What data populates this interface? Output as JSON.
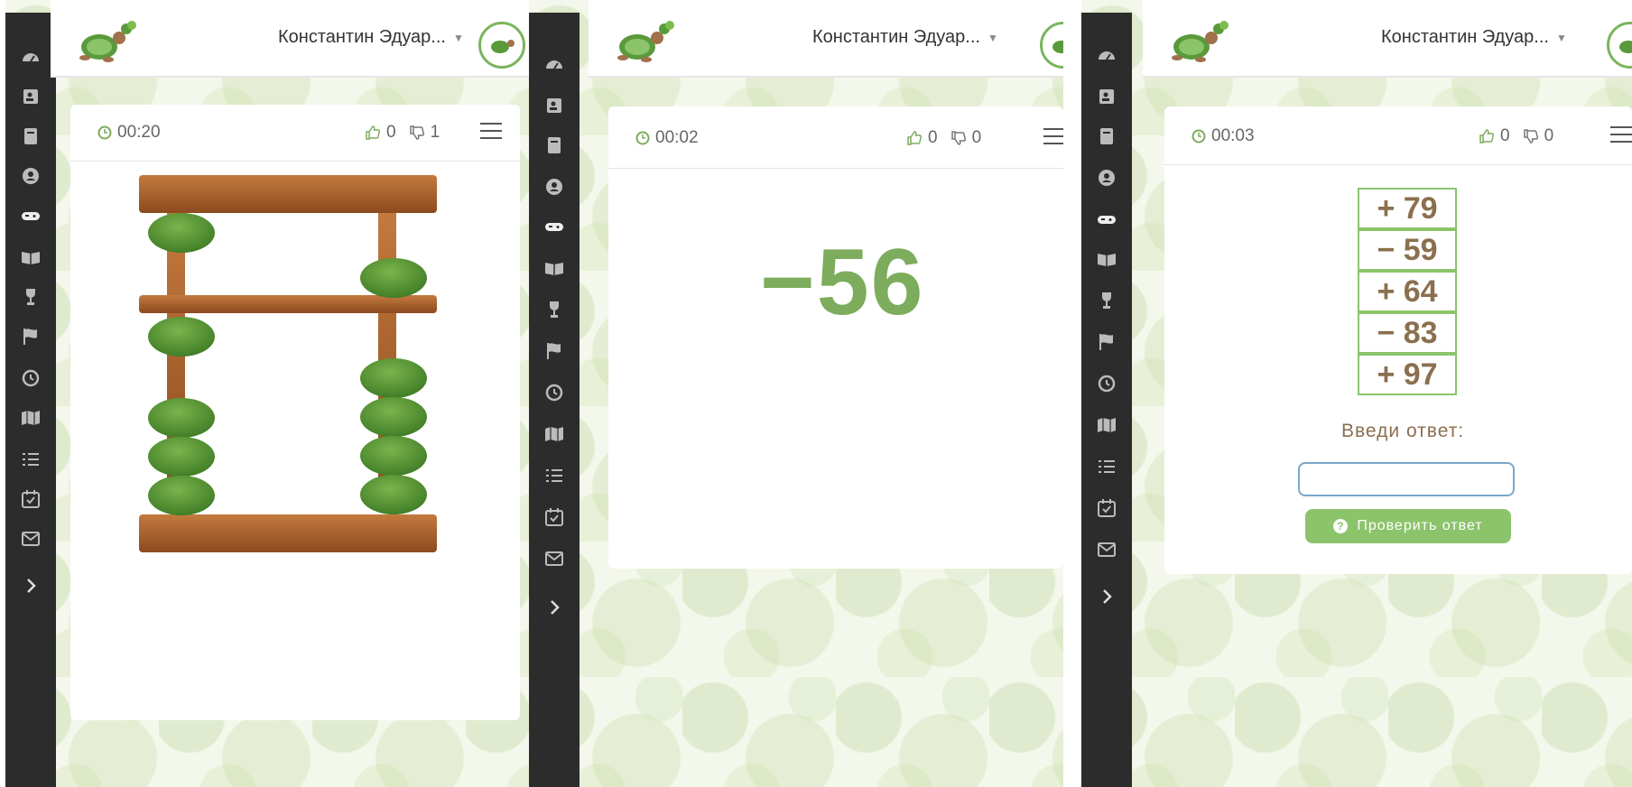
{
  "user": {
    "name": "Константин Эдуар..."
  },
  "panels": [
    {
      "timer": "00:20",
      "likes": "0",
      "dislikes": "1"
    },
    {
      "timer": "00:02",
      "likes": "0",
      "dislikes": "0",
      "number": "−56"
    },
    {
      "timer": "00:03",
      "likes": "0",
      "dislikes": "0",
      "terms": [
        "+ 79",
        "− 59",
        "+ 64",
        "− 83",
        "+ 97"
      ],
      "prompt": "Введи ответ:",
      "answer_value": "",
      "check_label": "Проверить ответ"
    }
  ],
  "abacus": {
    "rods": [
      {
        "upper_active": false,
        "lower_count": 4
      },
      {
        "upper_active": true,
        "lower_count": 4
      }
    ]
  },
  "sidebar": {
    "icons": [
      "dashboard-icon",
      "contacts-icon",
      "book-icon",
      "profile-icon",
      "gamepad-icon",
      "open-book-icon",
      "trophy-icon",
      "flag-icon",
      "history-icon",
      "map-icon",
      "list-icon",
      "calendar-check-icon",
      "envelope-icon",
      "chevron-right-icon"
    ]
  },
  "colors": {
    "sidebar": "#2c2c2c",
    "green": "#7cac5c",
    "brown": "#8b6f4e",
    "wood": "#a0522d"
  }
}
